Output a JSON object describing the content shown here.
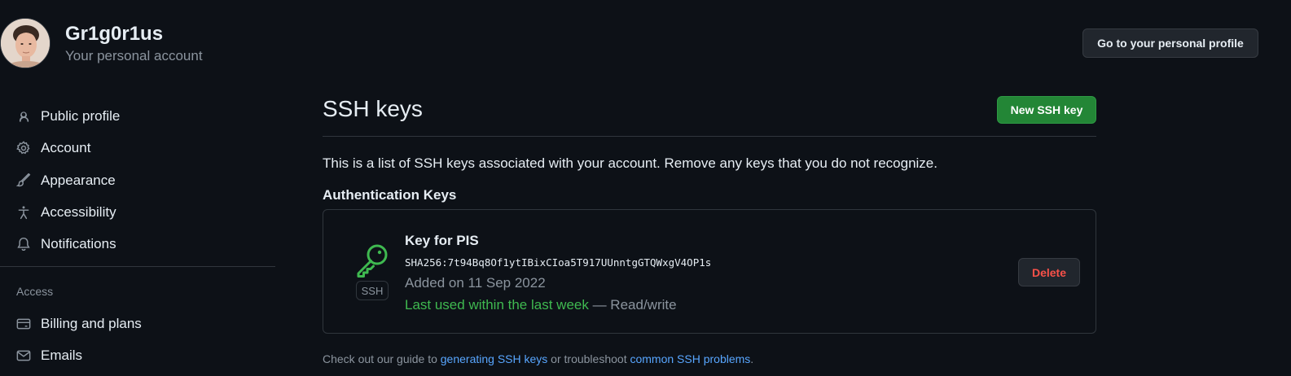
{
  "header": {
    "username": "Gr1g0r1us",
    "subtitle": "Your personal account",
    "profile_button": "Go to your personal profile"
  },
  "sidebar": {
    "items": [
      {
        "label": "Public profile",
        "icon": "person-icon"
      },
      {
        "label": "Account",
        "icon": "gear-icon"
      },
      {
        "label": "Appearance",
        "icon": "paintbrush-icon"
      },
      {
        "label": "Accessibility",
        "icon": "accessibility-icon"
      },
      {
        "label": "Notifications",
        "icon": "bell-icon"
      }
    ],
    "access_heading": "Access",
    "access_items": [
      {
        "label": "Billing and plans",
        "icon": "credit-card-icon"
      },
      {
        "label": "Emails",
        "icon": "mail-icon"
      }
    ]
  },
  "main": {
    "title": "SSH keys",
    "new_key_button": "New SSH key",
    "intro": "This is a list of SSH keys associated with your account. Remove any keys that you do not recognize.",
    "section_heading": "Authentication Keys",
    "keys": [
      {
        "title": "Key for PIS",
        "fingerprint": "SHA256:7t94Bq8Of1ytIBixCIoa5T917UUnntgGTQWxgV4OP1s",
        "badge": "SSH",
        "added": "Added on 11 Sep 2022",
        "last_used": "Last used within the last week",
        "access": " — Read/write",
        "delete_label": "Delete"
      }
    ],
    "footer": {
      "prefix": "Check out our guide to ",
      "link1": "generating SSH keys",
      "middle": " or troubleshoot ",
      "link2": "common SSH problems",
      "suffix": "."
    }
  },
  "colors": {
    "background": "#0d1117",
    "primary_button": "#238636",
    "success_text": "#3fb950",
    "danger_text": "#f85149",
    "link": "#58a6ff"
  }
}
